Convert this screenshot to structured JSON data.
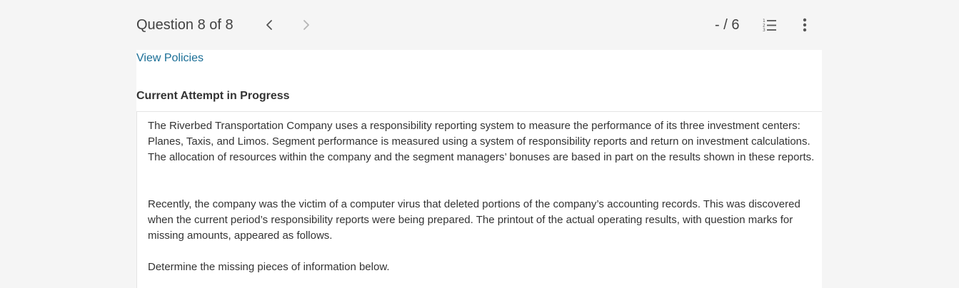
{
  "header": {
    "question_label": "Question 8 of 8",
    "score": "- / 6",
    "prev_icon": "chevron-left-icon",
    "next_icon": "chevron-right-icon",
    "list_icon": "numbered-list-icon",
    "more_icon": "more-vertical-icon"
  },
  "links": {
    "view_policies": "View Policies"
  },
  "attempt": {
    "heading": "Current Attempt in Progress"
  },
  "question": {
    "paragraphs": [
      "The Riverbed Transportation Company uses a responsibility reporting system to measure the performance of its three investment centers: Planes, Taxis, and Limos. Segment performance is measured using a system of responsibility reports and return on investment calculations. The allocation of resources within the company and the segment managers’ bonuses are based in part on the results shown in these reports.",
      "Recently, the company was the victim of a computer virus that deleted portions of the company’s accounting records. This was discovered when the current period’s responsibility reports were being prepared. The printout of the actual operating results, with question marks for missing amounts, appeared as follows.",
      "Determine the missing pieces of information below."
    ]
  },
  "colors": {
    "link": "#1a6e96",
    "background": "#f5f5f5",
    "panel": "#ffffff",
    "text": "#333333"
  }
}
